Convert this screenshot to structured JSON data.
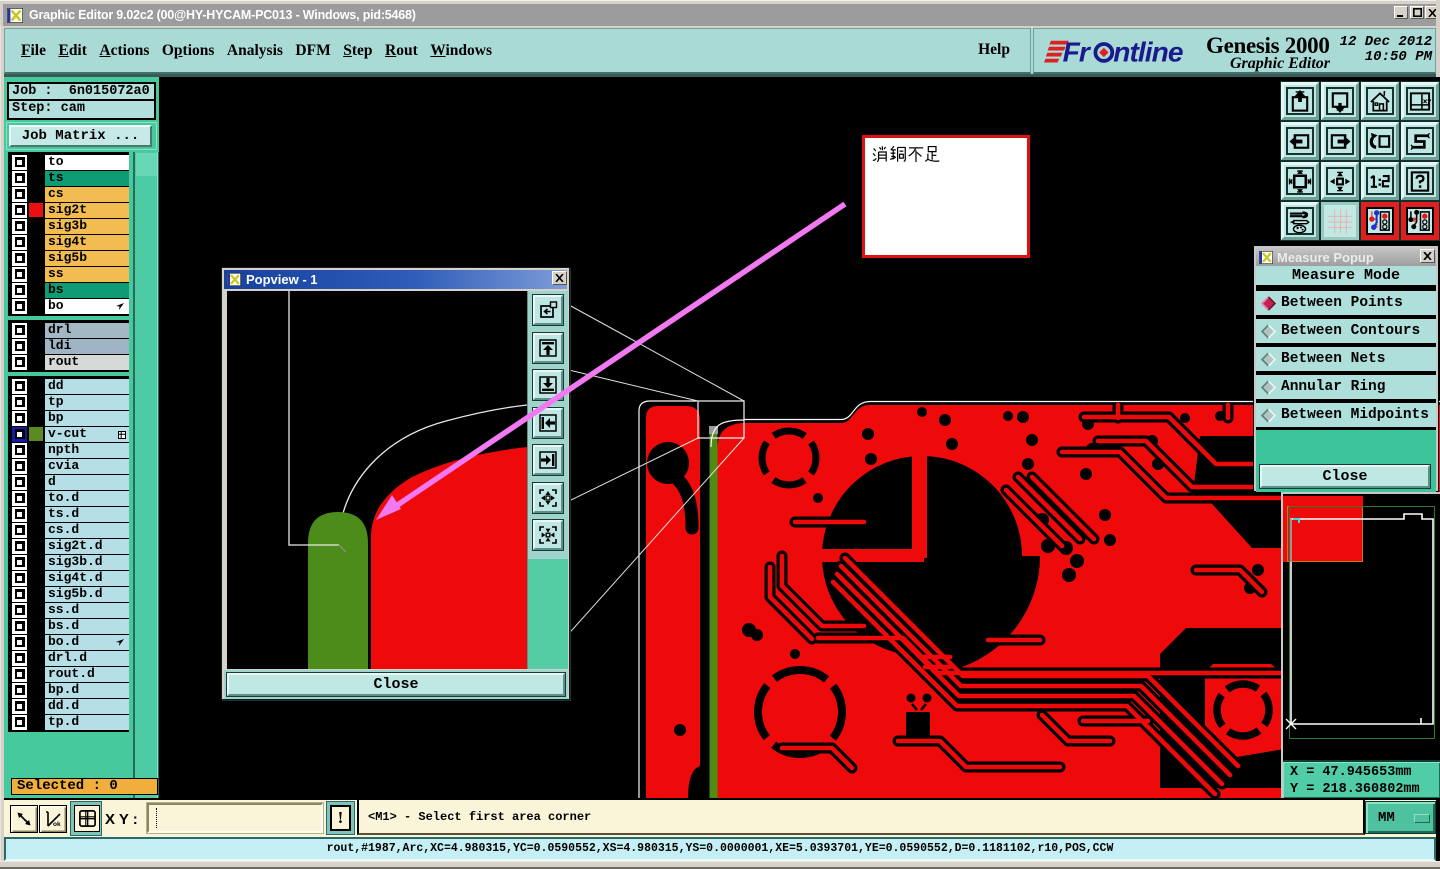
{
  "window": {
    "title": "Graphic Editor 9.02c2 (00@HY-HYCAM-PC013 - Windows, pid:5468)",
    "controls": [
      "minimize",
      "maximize",
      "close"
    ]
  },
  "menu": {
    "items": [
      {
        "label": "File",
        "underline": 0
      },
      {
        "label": "Edit",
        "underline": 0
      },
      {
        "label": "Actions",
        "underline": 0
      },
      {
        "label": "Options",
        "underline": 1
      },
      {
        "label": "Analysis",
        "underline": -1
      },
      {
        "label": "DFM",
        "underline": -1
      },
      {
        "label": "Step",
        "underline": 0
      },
      {
        "label": "Rout",
        "underline": 0
      },
      {
        "label": "Windows",
        "underline": 0
      }
    ],
    "help": {
      "label": "Help",
      "underline": -1
    }
  },
  "brand": {
    "logo": "Frontline",
    "product": "Genesis 2000",
    "date": "12 Dec 2012",
    "time": "10:50 PM",
    "subtitle": "Graphic Editor"
  },
  "job_panel": {
    "job_label": "Job :",
    "job_value": "6n015072a0",
    "step_label": "Step:",
    "step_value": "cam",
    "job_matrix_button": "Job Matrix ...",
    "selected_text": "Selected : 0"
  },
  "layers": {
    "groups": [
      [
        {
          "name": "to",
          "bg": "#FFFFFF",
          "swatch": null,
          "glyph": null
        },
        {
          "name": "ts",
          "bg": "#0E9C74",
          "swatch": null,
          "glyph": null
        },
        {
          "name": "cs",
          "bg": "#F2BC50",
          "swatch": null,
          "glyph": null
        },
        {
          "name": "sig2t",
          "bg": "#F2BC50",
          "swatch": "#E81010",
          "glyph": null
        },
        {
          "name": "sig3b",
          "bg": "#F2BC50",
          "swatch": null,
          "glyph": null
        },
        {
          "name": "sig4t",
          "bg": "#F2BC50",
          "swatch": null,
          "glyph": null
        },
        {
          "name": "sig5b",
          "bg": "#F2BC50",
          "swatch": null,
          "glyph": null
        },
        {
          "name": "ss",
          "bg": "#F2BC50",
          "swatch": null,
          "glyph": null
        },
        {
          "name": "bs",
          "bg": "#0E9C74",
          "swatch": null,
          "glyph": null
        },
        {
          "name": "bo",
          "bg": "#FFFFFF",
          "swatch": null,
          "glyph": "cursor"
        }
      ],
      [
        {
          "name": "drl",
          "bg": "#A3B8C4",
          "swatch": null,
          "glyph": null
        },
        {
          "name": "ldi",
          "bg": "#9FB4C4",
          "swatch": null,
          "glyph": null
        },
        {
          "name": "rout",
          "bg": "#D6DAD6",
          "swatch": null,
          "glyph": null
        }
      ],
      [
        {
          "name": "dd",
          "bg": "#B6DEE6",
          "swatch": null,
          "glyph": null
        },
        {
          "name": "tp",
          "bg": "#B6DEE6",
          "swatch": null,
          "glyph": null
        },
        {
          "name": "bp",
          "bg": "#B6DEE6",
          "swatch": null,
          "glyph": null
        },
        {
          "name": "v-cut",
          "bg": "#B6DEE6",
          "swatch": "#5A8A20",
          "glyph": "grid",
          "checked": true
        },
        {
          "name": "npth",
          "bg": "#B6DEE6",
          "swatch": null,
          "glyph": null
        },
        {
          "name": "cvia",
          "bg": "#B6DEE6",
          "swatch": null,
          "glyph": null
        },
        {
          "name": "d",
          "bg": "#B6DEE6",
          "swatch": null,
          "glyph": null
        },
        {
          "name": "to.d",
          "bg": "#B6DEE6",
          "swatch": null,
          "glyph": null
        },
        {
          "name": "ts.d",
          "bg": "#B6DEE6",
          "swatch": null,
          "glyph": null
        },
        {
          "name": "cs.d",
          "bg": "#B6DEE6",
          "swatch": null,
          "glyph": null
        },
        {
          "name": "sig2t.d",
          "bg": "#B6DEE6",
          "swatch": null,
          "glyph": null
        },
        {
          "name": "sig3b.d",
          "bg": "#B6DEE6",
          "swatch": null,
          "glyph": null
        },
        {
          "name": "sig4t.d",
          "bg": "#B6DEE6",
          "swatch": null,
          "glyph": null
        },
        {
          "name": "sig5b.d",
          "bg": "#B6DEE6",
          "swatch": null,
          "glyph": null
        },
        {
          "name": "ss.d",
          "bg": "#B6DEE6",
          "swatch": null,
          "glyph": null
        },
        {
          "name": "bs.d",
          "bg": "#B6DEE6",
          "swatch": null,
          "glyph": null
        },
        {
          "name": "bo.d",
          "bg": "#B6DEE6",
          "swatch": null,
          "glyph": "cursor"
        },
        {
          "name": "drl.d",
          "bg": "#B6DEE6",
          "swatch": null,
          "glyph": null
        },
        {
          "name": "rout.d",
          "bg": "#B6DEE6",
          "swatch": null,
          "glyph": null
        },
        {
          "name": "bp.d",
          "bg": "#B6DEE6",
          "swatch": null,
          "glyph": null
        },
        {
          "name": "dd.d",
          "bg": "#B6DEE6",
          "swatch": null,
          "glyph": null
        },
        {
          "name": "tp.d",
          "bg": "#B6DEE6",
          "swatch": null,
          "glyph": null
        }
      ]
    ]
  },
  "popview": {
    "title": "Popview - 1",
    "close_button": "Close",
    "toolbar_icons": [
      "window-copy-icon",
      "arrow-up-box-icon",
      "arrow-down-box-icon",
      "arrow-left-box-icon",
      "arrow-right-box-icon",
      "arrows-in-icon",
      "arrows-out-icon"
    ]
  },
  "measure_popup": {
    "title": "Measure Popup",
    "header": "Measure Mode",
    "options": [
      {
        "label": "Between Points",
        "selected": true
      },
      {
        "label": "Between Contours",
        "selected": false
      },
      {
        "label": "Between Nets",
        "selected": false
      },
      {
        "label": "Annular Ring",
        "selected": false
      },
      {
        "label": "Between Midpoints",
        "selected": false
      }
    ],
    "close_button": "Close"
  },
  "annotation": {
    "text": "消铜不足"
  },
  "overview": {
    "x_readout": "X = 47.945653mm",
    "y_readout": "Y = 218.360802mm"
  },
  "xy_bar": {
    "label": "X Y :",
    "input_value": "",
    "alert_button": "!",
    "message": "<M1> - Select first area corner",
    "units": "MM"
  },
  "status_bar": {
    "text": "rout,#1987,Arc,XC=4.980315,YC=0.0590552,XS=4.980315,YS=0.0000001,XE=5.0393701,YE=0.0590552,D=0.1181102,r10,POS,CCW"
  },
  "toolbar": {
    "icons": [
      "zoom-in-icon",
      "zoom-out-icon",
      "home-view-icon",
      "windows-xy-icon",
      "pan-left-icon",
      "pan-right-icon",
      "previous-view-icon",
      "serpentine-icon",
      "zoom-margins-icon",
      "zoom-center-icon",
      "scale-1-2-icon",
      "help-query-icon",
      "setup-tools-icon",
      "grid-icon",
      "netlist-color-icon",
      "netlist-black-icon"
    ],
    "active": [
      14,
      15
    ],
    "scale_label": "1:2",
    "help_label": "?"
  },
  "colors": {
    "copper_red": "#EE0A0A",
    "vcut_green": "#4E8C14",
    "pill_green": "#4C8C1A",
    "arrow_magenta": "#F279F2",
    "panel_teal": "#A9DAD6",
    "panel_green": "#46C99C",
    "cream": "#FAF5D8",
    "status_cyan": "#C6EFF5",
    "selected_orange": "#F0AE3C",
    "annotation_border": "#DD1111"
  }
}
